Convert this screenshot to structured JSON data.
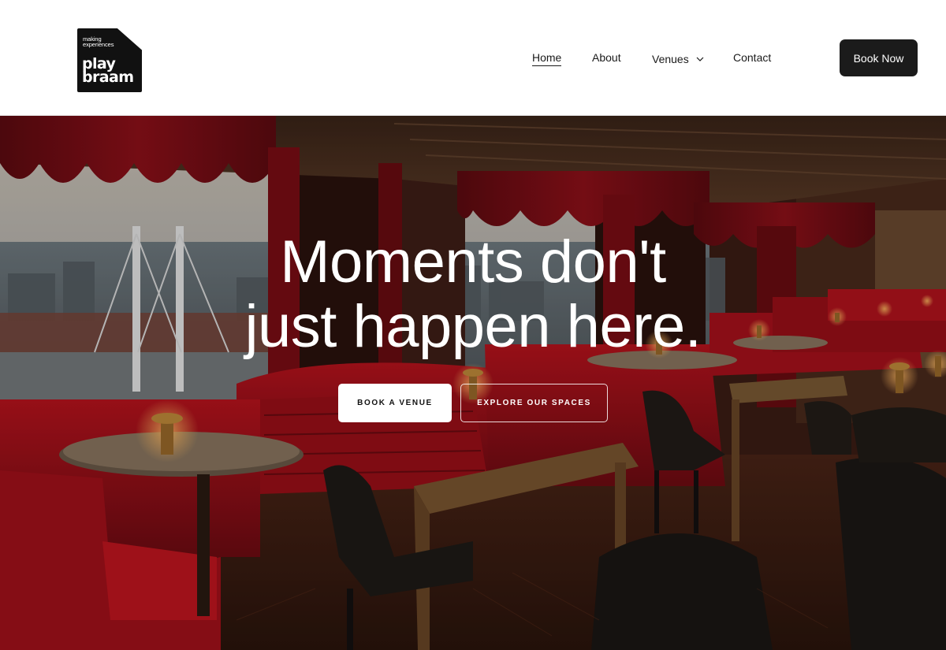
{
  "brand": {
    "tagline_line1": "making",
    "tagline_line2": "experiences",
    "name_line1": "play",
    "name_line2": "braam"
  },
  "nav": {
    "items": [
      {
        "label": "Home",
        "active": true
      },
      {
        "label": "About"
      },
      {
        "label": "Venues",
        "has_dropdown": true
      },
      {
        "label": "Contact"
      }
    ],
    "cta_label": "Book Now"
  },
  "hero": {
    "headline_line1": "Moments don't",
    "headline_line2": "just happen here.",
    "primary_button": "BOOK A VENUE",
    "secondary_button": "EXPLORE OUR SPACES",
    "image_alt": "Restaurant interior with red velvet booths and city view windows"
  },
  "colors": {
    "header_bg": "#ffffff",
    "logo_bg": "#111111",
    "cta_bg": "#1b1b1b",
    "velvet_red": "#a31019",
    "text_dark": "#1a1a1a"
  }
}
